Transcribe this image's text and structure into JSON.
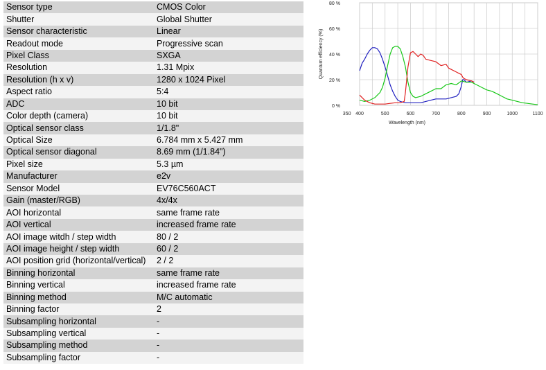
{
  "specs": [
    {
      "label": "Sensor type",
      "value": "CMOS Color"
    },
    {
      "label": "Shutter",
      "value": "Global Shutter"
    },
    {
      "label": "Sensor characteristic",
      "value": "Linear"
    },
    {
      "label": "Readout mode",
      "value": "Progressive scan"
    },
    {
      "label": "Pixel Class",
      "value": "SXGA"
    },
    {
      "label": "Resolution",
      "value": "1.31 Mpix"
    },
    {
      "label": "Resolution (h x v)",
      "value": "1280 x 1024 Pixel"
    },
    {
      "label": "Aspect ratio",
      "value": "5:4"
    },
    {
      "label": "ADC",
      "value": "10 bit"
    },
    {
      "label": "Color depth (camera)",
      "value": "10 bit"
    },
    {
      "label": "Optical sensor class",
      "value": "1/1.8\""
    },
    {
      "label": "Optical Size",
      "value": "6.784 mm x 5.427 mm"
    },
    {
      "label": "Optical sensor diagonal",
      "value": "8.69 mm (1/1.84\")"
    },
    {
      "label": "Pixel size",
      "value": "5.3 µm"
    },
    {
      "label": "Manufacturer",
      "value": "e2v"
    },
    {
      "label": "Sensor Model",
      "value": "EV76C560ACT"
    },
    {
      "label": "Gain (master/RGB)",
      "value": "4x/4x"
    },
    {
      "label": "AOI horizontal",
      "value": "same frame rate"
    },
    {
      "label": "AOI vertical",
      "value": "increased frame rate"
    },
    {
      "label": "AOI image witdh / step width",
      "value": "80 / 2"
    },
    {
      "label": "AOI image height / step width",
      "value": "60 / 2"
    },
    {
      "label": "AOI position grid (horizontal/vertical)",
      "value": "2 / 2"
    },
    {
      "label": "Binning horizontal",
      "value": "same frame rate"
    },
    {
      "label": "Binning vertical",
      "value": "increased frame rate"
    },
    {
      "label": "Binning method",
      "value": "M/C automatic"
    },
    {
      "label": "Binning factor",
      "value": "2"
    },
    {
      "label": "Subsampling horizontal",
      "value": "-"
    },
    {
      "label": "Subsampling vertical",
      "value": "-"
    },
    {
      "label": "Subsampling method",
      "value": "-"
    },
    {
      "label": "Subsampling factor",
      "value": "-"
    }
  ],
  "chart_data": {
    "type": "line",
    "title": "",
    "xlabel": "Wavelength (nm)",
    "ylabel": "Quantum efficiency (%)",
    "xlim": [
      350,
      1100
    ],
    "ylim": [
      0,
      80
    ],
    "x_ticks": [
      350,
      400,
      500,
      600,
      700,
      800,
      900,
      1000,
      1100
    ],
    "x_grid": [
      400,
      450,
      500,
      550,
      600,
      650,
      700,
      750,
      800,
      850,
      900,
      950,
      1000,
      1050,
      1100
    ],
    "y_ticks": [
      0,
      20,
      40,
      60,
      80
    ],
    "y_tick_labels": [
      "0 %",
      "20 %",
      "40 %",
      "60 %",
      "80 %"
    ],
    "grid": true,
    "legend": "none",
    "series": [
      {
        "color": "#2020c0",
        "points": [
          [
            400,
            27
          ],
          [
            410,
            33
          ],
          [
            420,
            36
          ],
          [
            430,
            40
          ],
          [
            440,
            43
          ],
          [
            450,
            45
          ],
          [
            460,
            45
          ],
          [
            470,
            44
          ],
          [
            480,
            41
          ],
          [
            490,
            36
          ],
          [
            500,
            30
          ],
          [
            510,
            23
          ],
          [
            520,
            16
          ],
          [
            530,
            11
          ],
          [
            540,
            7
          ],
          [
            550,
            4
          ],
          [
            560,
            3
          ],
          [
            580,
            2
          ],
          [
            600,
            2
          ],
          [
            620,
            2
          ],
          [
            640,
            2
          ],
          [
            660,
            3
          ],
          [
            680,
            4
          ],
          [
            700,
            5
          ],
          [
            720,
            5
          ],
          [
            740,
            5
          ],
          [
            760,
            6
          ],
          [
            780,
            7
          ],
          [
            790,
            9
          ],
          [
            800,
            15
          ],
          [
            805,
            20
          ],
          [
            810,
            20
          ],
          [
            820,
            18
          ],
          [
            840,
            19
          ],
          [
            850,
            18
          ]
        ]
      },
      {
        "color": "#18c818",
        "points": [
          [
            400,
            4
          ],
          [
            420,
            3
          ],
          [
            440,
            4
          ],
          [
            460,
            6
          ],
          [
            470,
            8
          ],
          [
            480,
            10
          ],
          [
            490,
            14
          ],
          [
            500,
            21
          ],
          [
            510,
            31
          ],
          [
            520,
            40
          ],
          [
            530,
            45
          ],
          [
            540,
            46
          ],
          [
            550,
            46
          ],
          [
            560,
            44
          ],
          [
            570,
            38
          ],
          [
            580,
            30
          ],
          [
            590,
            18
          ],
          [
            600,
            10
          ],
          [
            610,
            7
          ],
          [
            620,
            6
          ],
          [
            640,
            7
          ],
          [
            660,
            9
          ],
          [
            680,
            11
          ],
          [
            700,
            13
          ],
          [
            720,
            13
          ],
          [
            740,
            16
          ],
          [
            760,
            17
          ],
          [
            780,
            16
          ],
          [
            800,
            19
          ],
          [
            820,
            18
          ],
          [
            840,
            18
          ],
          [
            860,
            16
          ],
          [
            880,
            14
          ],
          [
            900,
            12
          ],
          [
            920,
            11
          ],
          [
            940,
            9
          ],
          [
            960,
            7
          ],
          [
            980,
            5
          ],
          [
            1000,
            4
          ],
          [
            1020,
            3
          ],
          [
            1040,
            2
          ],
          [
            1060,
            1.5
          ],
          [
            1080,
            1
          ],
          [
            1100,
            0.5
          ]
        ]
      },
      {
        "color": "#e02020",
        "points": [
          [
            400,
            8
          ],
          [
            410,
            6
          ],
          [
            420,
            4
          ],
          [
            430,
            3
          ],
          [
            440,
            2
          ],
          [
            460,
            1
          ],
          [
            480,
            1
          ],
          [
            500,
            1
          ],
          [
            520,
            1.5
          ],
          [
            540,
            2
          ],
          [
            560,
            2
          ],
          [
            575,
            3
          ],
          [
            580,
            10
          ],
          [
            590,
            30
          ],
          [
            600,
            41
          ],
          [
            610,
            42
          ],
          [
            620,
            40
          ],
          [
            630,
            38
          ],
          [
            640,
            40
          ],
          [
            650,
            39
          ],
          [
            660,
            36
          ],
          [
            680,
            35
          ],
          [
            700,
            34
          ],
          [
            720,
            31
          ],
          [
            740,
            32
          ],
          [
            750,
            29
          ],
          [
            760,
            28
          ],
          [
            780,
            26
          ],
          [
            790,
            25
          ],
          [
            800,
            24
          ],
          [
            805,
            22
          ],
          [
            810,
            21
          ],
          [
            820,
            20
          ],
          [
            840,
            19
          ],
          [
            850,
            18
          ]
        ]
      }
    ]
  }
}
